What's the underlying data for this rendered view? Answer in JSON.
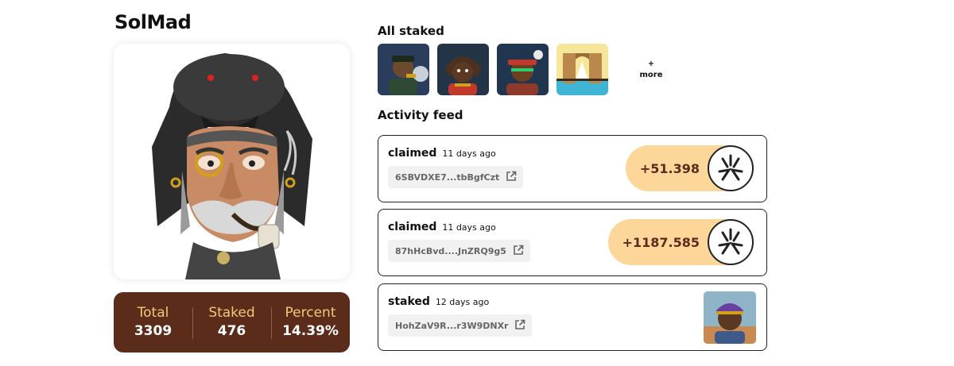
{
  "collection": {
    "title": "SolMad"
  },
  "stats": [
    {
      "label": "Total",
      "value": "3309"
    },
    {
      "label": "Staked",
      "value": "476"
    },
    {
      "label": "Percent",
      "value": "14.39%"
    }
  ],
  "all_staked": {
    "title": "All staked",
    "thumbnails": [
      "nft-thumbnail",
      "nft-thumbnail",
      "nft-thumbnail",
      "nft-thumbnail"
    ],
    "more_plus": "+",
    "more_label": "more"
  },
  "activity": {
    "title": "Activity feed",
    "items": [
      {
        "action": "claimed",
        "time": "11 days ago",
        "tx": "6SBVDXE7...tbBgfCzt",
        "amount": "+51.398"
      },
      {
        "action": "claimed",
        "time": "11 days ago",
        "tx": "87hHcBvd....JnZRQ9g5",
        "amount": "+1187.585"
      },
      {
        "action": "staked",
        "time": "12 days ago",
        "tx": "HohZaV9R...r3W9DNXr"
      }
    ]
  },
  "colors": {
    "brown": "#5b2c1a",
    "gold": "#f5c87a",
    "pill": "#fdd79a"
  },
  "icons": {
    "external_link": "external-link-icon",
    "token": "token-icon"
  }
}
